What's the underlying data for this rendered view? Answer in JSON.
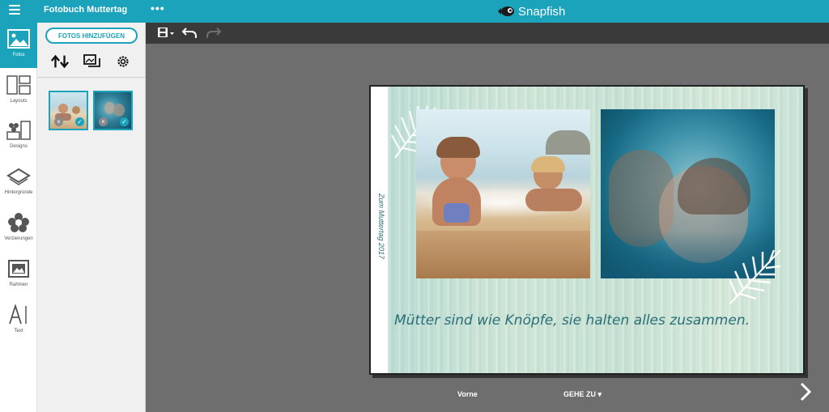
{
  "topbar": {
    "doc_title": "Fotobuch Muttertag",
    "more_label": "•••",
    "brand_name": "Snapfish",
    "color": "#1ba3bb"
  },
  "leftnav": {
    "items": [
      {
        "label": "Fotos",
        "icon": "photos-icon",
        "active": true
      },
      {
        "label": "Layouts",
        "icon": "layouts-icon"
      },
      {
        "label": "Designs",
        "icon": "designs-icon"
      },
      {
        "label": "Hintergründe",
        "icon": "backgrounds-icon"
      },
      {
        "label": "Verzierungen",
        "icon": "embellishments-icon"
      },
      {
        "label": "Rahmen",
        "icon": "frames-icon"
      },
      {
        "label": "Text",
        "icon": "text-icon"
      }
    ]
  },
  "photopanel": {
    "add_button": "FOTOS HINZUFÜGEN",
    "tools": [
      "sort-icon",
      "photo-swap-icon",
      "settings-icon"
    ],
    "thumbnails": [
      {
        "name": "beach-kids-thumb",
        "used": true
      },
      {
        "name": "mother-daughter-thumb",
        "used": true
      }
    ]
  },
  "toolbar": {
    "items": [
      "save-icon",
      "undo-icon",
      "redo-icon"
    ]
  },
  "spread": {
    "spine_text": "Zum Muttertag 2017",
    "quote": "Mütter sind wie Knöpfe, sie halten alles zusammen."
  },
  "bottom": {
    "page_label": "Vorne",
    "goto_label": "GEHE ZU ▾"
  }
}
